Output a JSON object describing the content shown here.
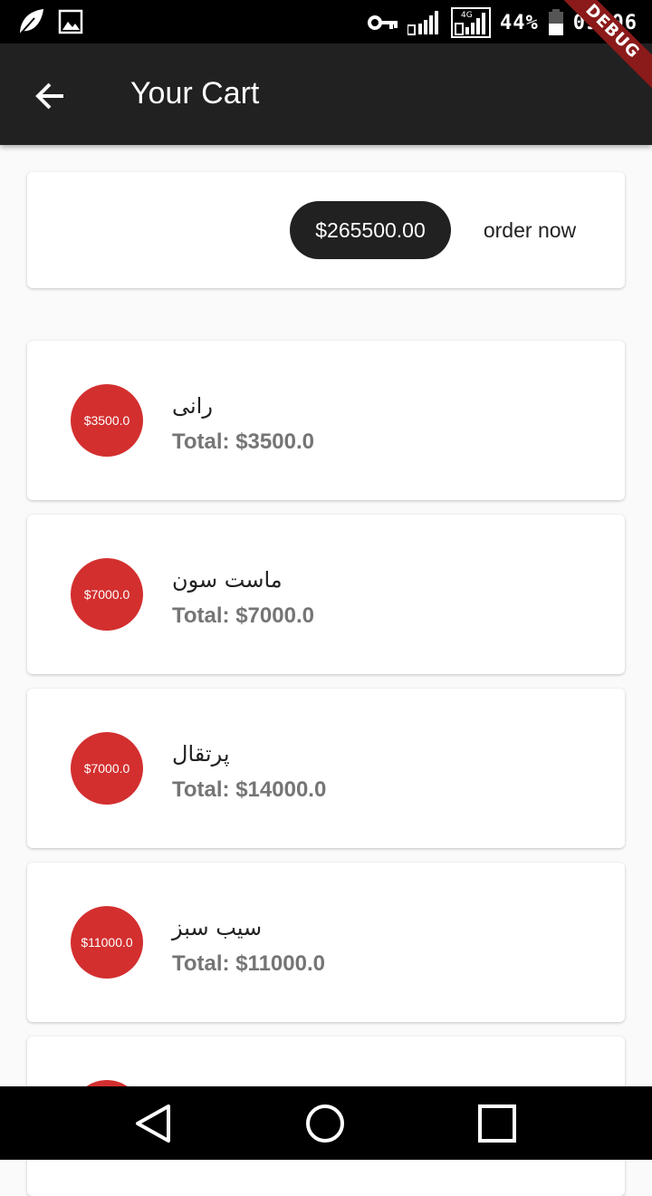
{
  "status_bar": {
    "battery": "44%",
    "time": "09:06",
    "network": "4G"
  },
  "app_bar": {
    "title": "Your Cart",
    "debug_label": "DEBUG"
  },
  "summary": {
    "total": "$265500.00",
    "order_label": "order now"
  },
  "items": [
    {
      "price": "$3500.0",
      "title": "رانی",
      "total": "Total: $3500.0"
    },
    {
      "price": "$7000.0",
      "title": "ماست سون",
      "total": "Total: $7000.0"
    },
    {
      "price": "$7000.0",
      "title": "پرتقال",
      "total": "Total: $14000.0"
    },
    {
      "price": "$11000.0",
      "title": "سیب سبز",
      "total": "Total: $11000.0"
    }
  ],
  "colors": {
    "accent": "#d32f2f",
    "appbar": "#212121",
    "background": "#fafafa"
  }
}
